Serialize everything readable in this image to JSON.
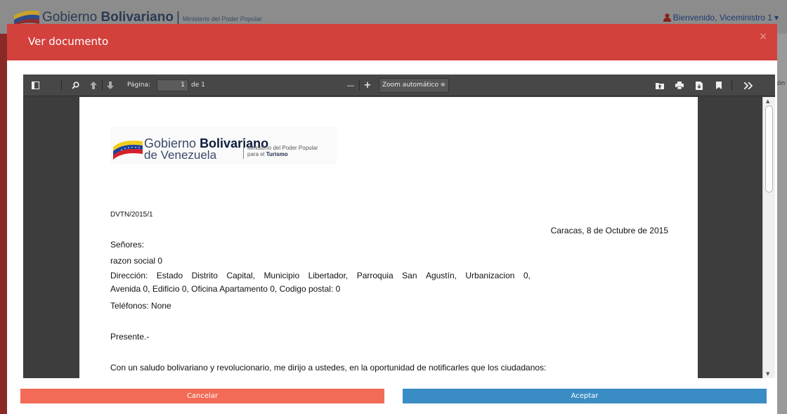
{
  "background": {
    "brand_light": "Gobierno ",
    "brand_bold": "Bolivariano",
    "brand_sep": "|",
    "ministry": "Ministerio del Poder Popular",
    "user_greeting": "Bienvenido, Viceministro 1",
    "user_caret": "▾",
    "right_edge_text": "ón"
  },
  "modal": {
    "title": "Ver documento",
    "close": "×",
    "cancel_label": "Cancelar",
    "accept_label": "Aceptar"
  },
  "viewer": {
    "page_label": "Página:",
    "page_value": "1",
    "page_of": "de 1",
    "zoom_value": "Zoom automático",
    "zoom_caret": "≑",
    "zoom_out": "—",
    "zoom_in": "+",
    "scroll_up": "▲",
    "scroll_down": "▼"
  },
  "document": {
    "letterhead": {
      "gob_light": "Gobierno ",
      "gob_bold": "Bolivariano",
      "venezuela": "de Venezuela",
      "ministry_line1": "Ministerio del Poder Popular",
      "ministry_line2_pre": "para el ",
      "ministry_line2_bold": "Turismo"
    },
    "reference": "DVTN/2015/1",
    "date": "Caracas, 8 de Octubre de 2015",
    "salutation": "Señores:",
    "company": "razon social 0",
    "address_line1_words": [
      "Dirección:",
      "Estado",
      "Distrito",
      "Capital,",
      "Municipio",
      "Libertador,",
      "Parroquia",
      "San",
      "Agustín,",
      "Urbanizacion",
      "0,"
    ],
    "address_line2": "Avenida 0, Edificio 0, Oficina Apartamento 0, Codigo postal: 0",
    "phones": "Teléfonos: None",
    "presente": "Presente.-",
    "greeting": "Con un saludo bolivariano y revolucionario, me dirijo a ustedes, en la oportunidad de notificarles que los ciudadanos:"
  },
  "colors": {
    "modal_header": "#d2413c",
    "cancel": "#f26b57",
    "accept": "#3a8dc4",
    "viewer_toolbar": "#474747"
  }
}
